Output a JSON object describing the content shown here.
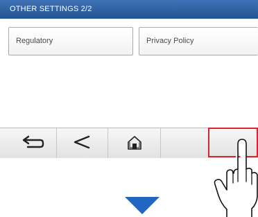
{
  "screen": {
    "title": "OTHER SETTINGS  2/2"
  },
  "settings": [
    {
      "label": "Regulatory"
    },
    {
      "label": "Privacy Policy"
    }
  ],
  "toolbar": {
    "buttons": [
      {
        "icon": "return-icon"
      },
      {
        "icon": "previous-page-icon"
      },
      {
        "icon": "home-icon"
      },
      {
        "icon": ""
      },
      {
        "icon": ""
      }
    ]
  },
  "annotation": {
    "highlight_color": "#d8242c",
    "arrow_color": "#2266c4"
  },
  "colors": {
    "title_bar": "#2f63a6",
    "toolbar": "#ececec"
  }
}
